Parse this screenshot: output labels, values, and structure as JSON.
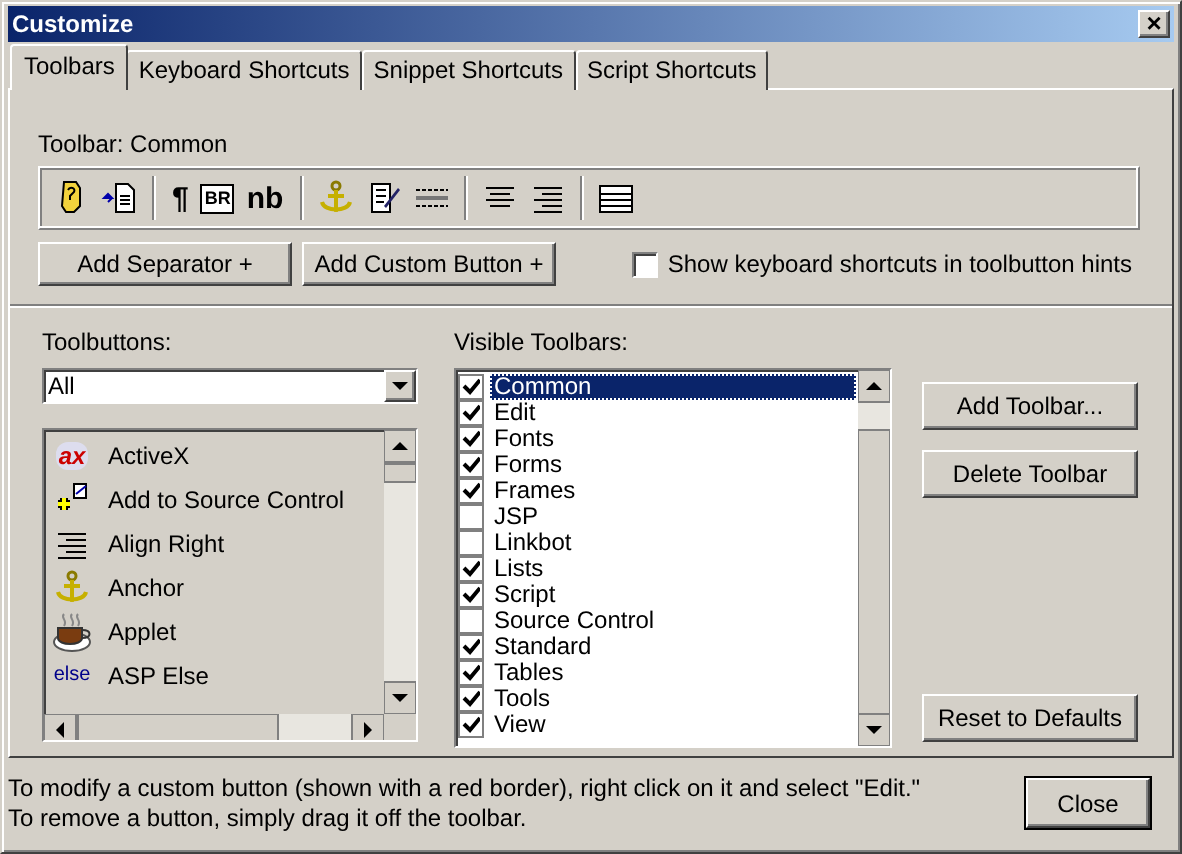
{
  "window": {
    "title": "Customize",
    "close": "×"
  },
  "tabs": [
    {
      "label": "Toolbars",
      "selected": true
    },
    {
      "label": "Keyboard Shortcuts",
      "selected": false
    },
    {
      "label": "Snippet Shortcuts",
      "selected": false
    },
    {
      "label": "Script Shortcuts",
      "selected": false
    }
  ],
  "toolbar": {
    "label": "Toolbar: Common",
    "buttons": [
      {
        "kind": "help"
      },
      {
        "kind": "page"
      },
      {
        "kind": "separator"
      },
      {
        "kind": "glyph",
        "text": "¶"
      },
      {
        "kind": "br",
        "text": "BR"
      },
      {
        "kind": "glyph",
        "text": "nb"
      },
      {
        "kind": "separator"
      },
      {
        "kind": "anchor"
      },
      {
        "kind": "edit"
      },
      {
        "kind": "rule"
      },
      {
        "kind": "separator"
      },
      {
        "kind": "center"
      },
      {
        "kind": "right"
      },
      {
        "kind": "separator"
      },
      {
        "kind": "table"
      }
    ],
    "actions": [
      "Add Separator +",
      "Add Custom Button +"
    ],
    "hints_option": {
      "label": "Show keyboard shortcuts in toolbutton hints",
      "checked": false
    }
  },
  "toolbuttons": {
    "label": "Toolbuttons:",
    "filter": "All",
    "items": [
      {
        "label": "ActiveX",
        "kind": "activex",
        "icon_text": "ax"
      },
      {
        "label": "Add to Source Control",
        "kind": "source"
      },
      {
        "label": "Align Right",
        "kind": "right"
      },
      {
        "label": "Anchor",
        "kind": "anchor"
      },
      {
        "label": "Applet",
        "kind": "cup"
      },
      {
        "label": "ASP Else",
        "kind": "word",
        "icon_text": "else"
      }
    ]
  },
  "visible_toolbars": {
    "label": "Visible Toolbars:",
    "items": [
      {
        "label": "Common",
        "checked": true,
        "selected": true
      },
      {
        "label": "Edit",
        "checked": true,
        "selected": false
      },
      {
        "label": "Fonts",
        "checked": true,
        "selected": false
      },
      {
        "label": "Forms",
        "checked": true,
        "selected": false
      },
      {
        "label": "Frames",
        "checked": true,
        "selected": false
      },
      {
        "label": "JSP",
        "checked": false,
        "selected": false
      },
      {
        "label": "Linkbot",
        "checked": false,
        "selected": false
      },
      {
        "label": "Lists",
        "checked": true,
        "selected": false
      },
      {
        "label": "Script",
        "checked": true,
        "selected": false
      },
      {
        "label": "Source Control",
        "checked": false,
        "selected": false
      },
      {
        "label": "Standard",
        "checked": true,
        "selected": false
      },
      {
        "label": "Tables",
        "checked": true,
        "selected": false
      },
      {
        "label": "Tools",
        "checked": true,
        "selected": false
      },
      {
        "label": "View",
        "checked": true,
        "selected": false
      }
    ],
    "buttons": [
      "Add Toolbar...",
      "Delete Toolbar"
    ],
    "reset": "Reset to Defaults"
  },
  "footer": {
    "hints": [
      "To modify a custom button (shown with a red border), right click on it and select \"Edit.\"",
      "To remove a button, simply drag it off the toolbar."
    ],
    "close": "Close"
  }
}
